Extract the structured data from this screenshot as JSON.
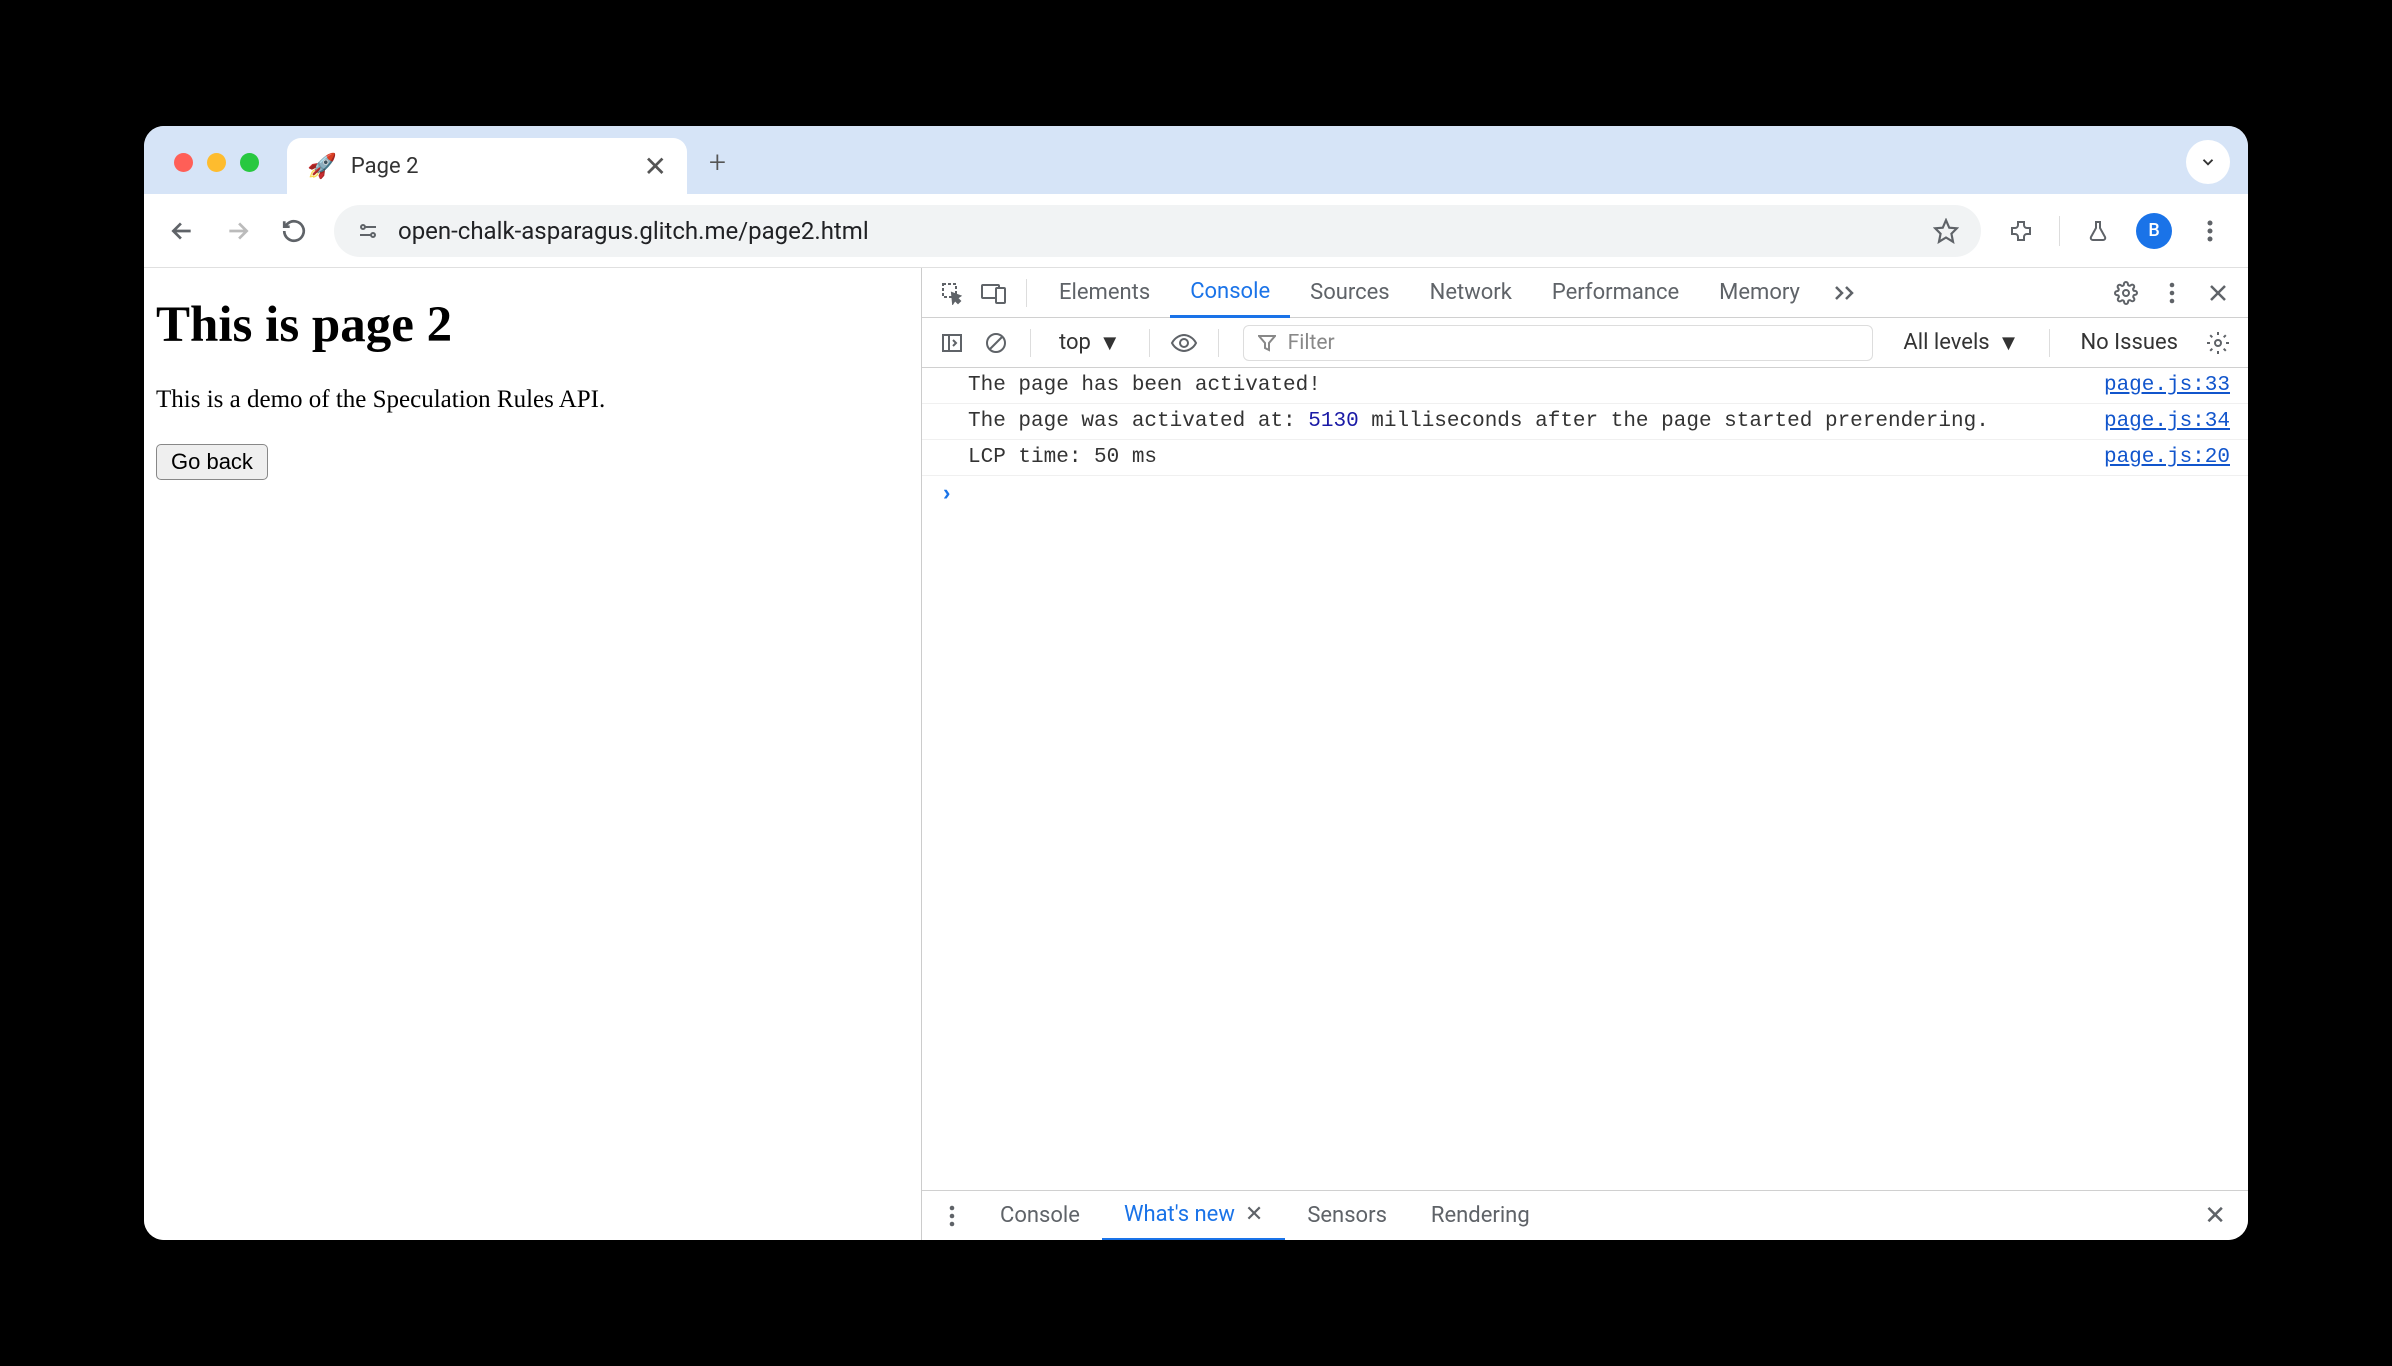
{
  "browser": {
    "tab_title": "Page 2",
    "favicon": "🚀",
    "url": "open-chalk-asparagus.glitch.me/page2.html",
    "avatar_letter": "B"
  },
  "page": {
    "heading": "This is page 2",
    "paragraph": "This is a demo of the Speculation Rules API.",
    "button_label": "Go back"
  },
  "devtools": {
    "tabs": [
      "Elements",
      "Console",
      "Sources",
      "Network",
      "Performance",
      "Memory"
    ],
    "active_tab": "Console",
    "console": {
      "context": "top",
      "filter_placeholder": "Filter",
      "levels_label": "All levels",
      "issues_label": "No Issues",
      "logs": [
        {
          "text_before": "The page has been activated!",
          "num": "",
          "text_after": "",
          "src": "page.js:33"
        },
        {
          "text_before": "The page was activated at: ",
          "num": "5130",
          "text_after": "  milliseconds after the page started prerendering.",
          "src": "page.js:34"
        },
        {
          "text_before": "LCP time: 50 ms",
          "num": "",
          "text_after": "",
          "src": "page.js:20"
        }
      ]
    },
    "drawer": {
      "tabs": [
        "Console",
        "What's new",
        "Sensors",
        "Rendering"
      ],
      "active_tab": "What's new"
    }
  }
}
